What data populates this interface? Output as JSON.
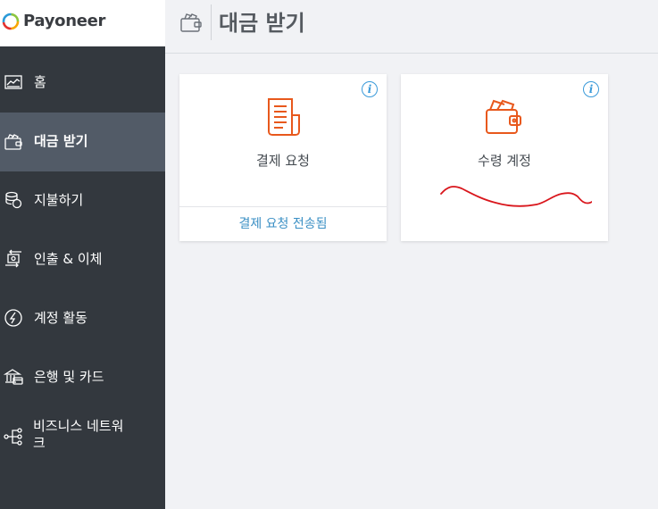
{
  "brand": {
    "name": "Payoneer"
  },
  "sidebar": {
    "items": [
      {
        "label": "홈",
        "icon": "chart-icon",
        "active": false
      },
      {
        "label": "대금 받기",
        "icon": "wallet-icon",
        "active": true
      },
      {
        "label": "지불하기",
        "icon": "coins-icon",
        "active": false
      },
      {
        "label": "인출 & 이체",
        "icon": "transfer-icon",
        "active": false
      },
      {
        "label": "계정 활동",
        "icon": "activity-icon",
        "active": false
      },
      {
        "label": "은행 및 카드",
        "icon": "bank-icon",
        "active": false
      },
      {
        "label": "비즈니스 네트워\n크",
        "icon": "network-icon",
        "active": false
      }
    ]
  },
  "header": {
    "title": "대금 받기",
    "icon": "wallet-icon"
  },
  "cards": [
    {
      "title": "결제 요청",
      "icon": "invoice-icon",
      "link": "결제 요청 전송됨",
      "info_icon": "info-icon"
    },
    {
      "title": "수령 계정",
      "icon": "wallet-cards-icon",
      "info_icon": "info-icon"
    }
  ],
  "colors": {
    "sidebar": "#33383e",
    "active": "#525b67",
    "accent": "#e8581c",
    "link": "#3a8fc4",
    "redaction": "#d9161c"
  }
}
